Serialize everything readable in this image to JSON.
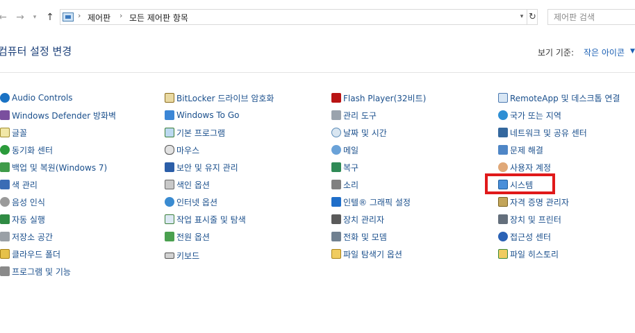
{
  "address": {
    "crumbs": [
      "제어판",
      "모든 제어판 항목"
    ],
    "search_placeholder": "제어판 검색"
  },
  "header": {
    "title": "컴퓨터 설정 변경",
    "view_label": "보기 기준:",
    "view_value": "작은 아이콘"
  },
  "items": [
    {
      "label": "Audio Controls",
      "icon": "hp-icon"
    },
    {
      "label": "BitLocker 드라이브 암호화",
      "icon": "bitlocker-icon"
    },
    {
      "label": "Flash Player(32비트)",
      "icon": "flash-icon"
    },
    {
      "label": "RemoteApp 및 데스크톱 연결",
      "icon": "remoteapp-icon"
    },
    {
      "label": "Windows Defender 방화벽",
      "icon": "firewall-icon"
    },
    {
      "label": "Windows To Go",
      "icon": "windows-to-go-icon"
    },
    {
      "label": "관리 도구",
      "icon": "admin-tools-icon"
    },
    {
      "label": "국가 또는 지역",
      "icon": "region-icon"
    },
    {
      "label": "글꼴",
      "icon": "font-icon"
    },
    {
      "label": "기본 프로그램",
      "icon": "default-programs-icon"
    },
    {
      "label": "날짜 및 시간",
      "icon": "clock-icon"
    },
    {
      "label": "네트워크 및 공유 센터",
      "icon": "network-icon"
    },
    {
      "label": "동기화 센터",
      "icon": "sync-icon"
    },
    {
      "label": "마우스",
      "icon": "mouse-icon"
    },
    {
      "label": "메일",
      "icon": "mail-icon"
    },
    {
      "label": "문제 해결",
      "icon": "troubleshoot-icon"
    },
    {
      "label": "백업 및 복원(Windows 7)",
      "icon": "backup-icon"
    },
    {
      "label": "보안 및 유지 관리",
      "icon": "flag-icon"
    },
    {
      "label": "복구",
      "icon": "recovery-icon"
    },
    {
      "label": "사용자 계정",
      "icon": "user-accounts-icon"
    },
    {
      "label": "색 관리",
      "icon": "color-management-icon"
    },
    {
      "label": "색인 옵션",
      "icon": "indexing-icon"
    },
    {
      "label": "소리",
      "icon": "speaker-icon"
    },
    {
      "label": "시스템",
      "icon": "system-icon"
    },
    {
      "label": "음성 인식",
      "icon": "microphone-icon"
    },
    {
      "label": "인터넷 옵션",
      "icon": "internet-options-icon"
    },
    {
      "label": "인텔® 그래픽 설정",
      "icon": "intel-graphics-icon"
    },
    {
      "label": "자격 증명 관리자",
      "icon": "credential-icon"
    },
    {
      "label": "자동 실행",
      "icon": "autoplay-icon"
    },
    {
      "label": "작업 표시줄 및 탐색",
      "icon": "taskbar-icon"
    },
    {
      "label": "장치 관리자",
      "icon": "device-manager-icon"
    },
    {
      "label": "장치 및 프린터",
      "icon": "printer-icon"
    },
    {
      "label": "저장소 공간",
      "icon": "storage-icon"
    },
    {
      "label": "전원 옵션",
      "icon": "power-icon"
    },
    {
      "label": "전화 및 모뎀",
      "icon": "phone-icon"
    },
    {
      "label": "접근성 센터",
      "icon": "accessibility-icon"
    },
    {
      "label": "클라우드 폴더",
      "icon": "cloud-folder-icon"
    },
    {
      "label": "키보드",
      "icon": "keyboard-icon"
    },
    {
      "label": "파일 탐색기 옵션",
      "icon": "folder-options-icon"
    },
    {
      "label": "파일 히스토리",
      "icon": "file-history-icon"
    },
    {
      "label": "프로그램 및 기능",
      "icon": "programs-icon"
    }
  ],
  "highlighted_item": "시스템"
}
